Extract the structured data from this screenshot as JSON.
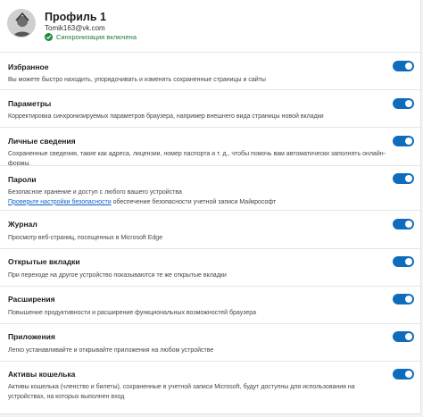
{
  "profile": {
    "name": "Профиль 1",
    "email": "Tomik163@vk.com",
    "sync_status": "Синхронизация включена",
    "sync_color": "#1a8a3a"
  },
  "accent_color": "#0f6cbd",
  "sync_items": [
    {
      "title": "Избранное",
      "description": "Вы можете быстро находить, упорядочивать и изменять сохраненные страницы и сайты",
      "enabled": true
    },
    {
      "title": "Параметры",
      "description": "Корректировка синхронизируемых параметров браузера, например внешнего вида страницы новой вкладки",
      "enabled": true
    },
    {
      "title": "Личные сведения",
      "description": "Сохраненные сведения, такие как адреса, лицензии, номер паспорта и т. д., чтобы помочь вам автоматически заполнять онлайн-формы.",
      "enabled": true
    },
    {
      "title": "Пароли",
      "description": "Безопасное хранение и доступ с любого вашего устройства",
      "link": "Проверьте настройки безопасности",
      "description2": " обеспечение безопасности учетной записи Майкрософт",
      "enabled": true
    },
    {
      "title": "Журнал",
      "description": "Просмотр веб-страниц, посещенных в Microsoft Edge",
      "enabled": true
    },
    {
      "title": "Открытые вкладки",
      "description": "При переходе на другое устройство показываются те же открытые вкладки",
      "enabled": true
    },
    {
      "title": "Расширения",
      "description": "Повышение продуктивности и расширение функциональных возможностей браузера",
      "enabled": true
    },
    {
      "title": "Приложения",
      "description": "Легко устанавливайте и открывайте приложения на любом устройстве",
      "enabled": true
    },
    {
      "title": "Активы кошелька",
      "description": "Активы кошелька (членство и билеты), сохраненные в учетной записи Microsoft, будут доступны для использования на устройствах, на которых выполнен вход",
      "enabled": true
    }
  ]
}
